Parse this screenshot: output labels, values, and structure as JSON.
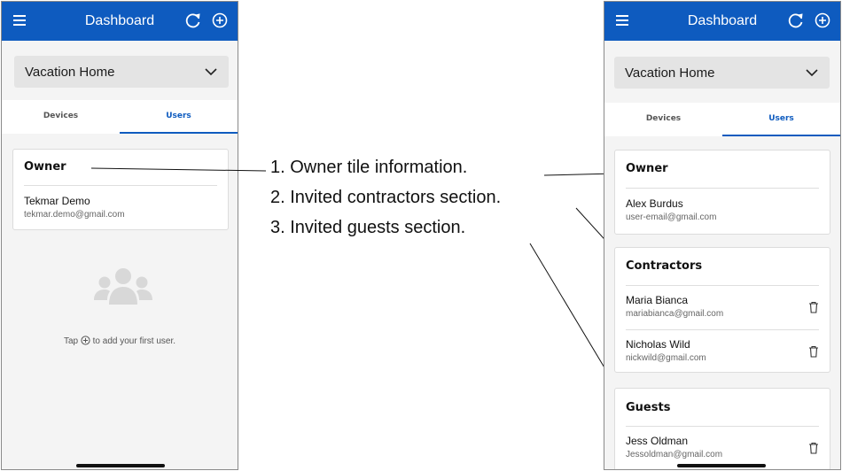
{
  "left_phone": {
    "appbar": {
      "title": "Dashboard"
    },
    "home_selector": {
      "value": "Vacation Home"
    },
    "tabs": [
      {
        "label": "Devices"
      },
      {
        "label": "Users"
      }
    ],
    "owner_card": {
      "title": "Owner",
      "name": "Tekmar Demo",
      "email": "tekmar.demo@gmail.com"
    },
    "empty_state": {
      "before": "Tap",
      "after": "to add your first user."
    }
  },
  "annotations": [
    "1. Owner tile information.",
    "2. Invited contractors section.",
    "3. Invited guests section."
  ],
  "right_phone": {
    "appbar": {
      "title": "Dashboard"
    },
    "home_selector": {
      "value": "Vacation Home"
    },
    "tabs": [
      {
        "label": "Devices"
      },
      {
        "label": "Users"
      }
    ],
    "owner_card": {
      "title": "Owner",
      "name": "Alex Burdus",
      "email": "user-email@gmail.com"
    },
    "contractors_card": {
      "title": "Contractors",
      "users": [
        {
          "name": "Maria Bianca",
          "email": "mariabianca@gmail.com"
        },
        {
          "name": "Nicholas Wild",
          "email": "nickwild@gmail.com"
        }
      ]
    },
    "guests_card": {
      "title": "Guests",
      "users": [
        {
          "name": "Jess Oldman",
          "email": "Jessoldman@gmail.com"
        }
      ]
    }
  },
  "colors": {
    "accent": "#0e5bbf",
    "background": "#f4f4f4",
    "card": "#ffffff"
  },
  "icons": [
    "menu-icon",
    "refresh-icon",
    "add-circle-icon",
    "chevron-down-icon",
    "users-group-icon",
    "trash-icon"
  ]
}
